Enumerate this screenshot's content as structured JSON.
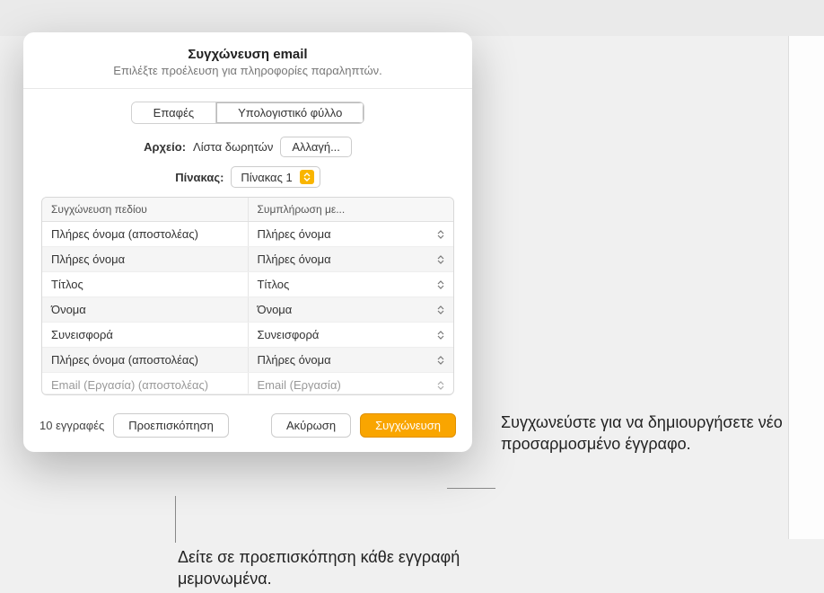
{
  "dialog": {
    "title": "Συγχώνευση email",
    "subtitle": "Επιλέξτε προέλευση για πληροφορίες παραληπτών.",
    "tabs": {
      "contacts": "Επαφές",
      "spreadsheet": "Υπολογιστικό φύλλο"
    },
    "file_label": "Αρχείο:",
    "file_value": "Λίστα δωρητών",
    "change_button": "Αλλαγή...",
    "table_label": "Πίνακας:",
    "table_value": "Πίνακας 1",
    "map_header_field": "Συγχώνευση πεδίου",
    "map_header_fill": "Συμπλήρωση με...",
    "rows": [
      {
        "field": "Πλήρες όνομα (αποστολέας)",
        "fill": "Πλήρες όνομα"
      },
      {
        "field": "Πλήρες όνομα",
        "fill": "Πλήρες όνομα"
      },
      {
        "field": "Τίτλος",
        "fill": "Τίτλος"
      },
      {
        "field": "Όνομα",
        "fill": "Όνομα"
      },
      {
        "field": "Συνεισφορά",
        "fill": "Συνεισφορά"
      },
      {
        "field": "Πλήρες όνομα (αποστολέας)",
        "fill": "Πλήρες όνομα"
      },
      {
        "field": "Email (Εργασία) (αποστολέας)",
        "fill": "Email (Εργασία)"
      }
    ],
    "records_count": "10 εγγραφές",
    "preview_button": "Προεπισκόπηση",
    "cancel_button": "Ακύρωση",
    "merge_button": "Συγχώνευση"
  },
  "callouts": {
    "merge": "Συγχωνεύστε για να δημιουργήσετε νέο προσαρμοσμένο έγγραφο.",
    "preview": "Δείτε σε προεπισκόπηση κάθε εγγραφή μεμονωμένα."
  }
}
